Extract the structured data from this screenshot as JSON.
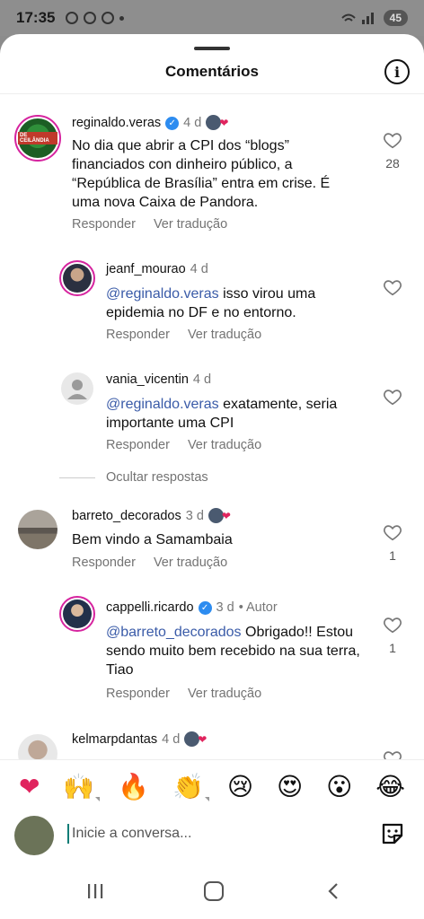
{
  "status_bar": {
    "time": "17:35",
    "battery": "45"
  },
  "header": {
    "title": "Comentários"
  },
  "comments": [
    {
      "username": "reginaldo.veras",
      "time": "4 d",
      "text": "No dia que abrir a CPI dos “blogs” financiados con dinheiro público, a “República de Brasília” entra em crise. É uma nova Caixa de Pandora.",
      "reply_label": "Responder",
      "translate_label": "Ver tradução",
      "like_count": "28",
      "avatar_text": "DE CEILÂNDIA"
    },
    {
      "username": "jeanf_mourao",
      "time": "4 d",
      "mention": "@reginaldo.veras",
      "text": " isso virou uma epidemia no DF e no entorno.",
      "reply_label": "Responder",
      "translate_label": "Ver tradução"
    },
    {
      "username": "vania_vicentin",
      "time": "4 d",
      "mention": "@reginaldo.veras",
      "text": " exatamente, seria importante uma CPI",
      "reply_label": "Responder",
      "translate_label": "Ver tradução"
    },
    {
      "username": "barreto_decorados",
      "time": "3 d",
      "text": "Bem vindo a Samambaia",
      "reply_label": "Responder",
      "translate_label": "Ver tradução",
      "like_count": "1"
    },
    {
      "username": "cappelli.ricardo",
      "time": "3 d",
      "author_label": "• Autor",
      "mention": "@barreto_decorados",
      "text": " Obrigado!! Estou sendo muito bem recebido na sua terra, Tiao",
      "reply_label": "Responder",
      "translate_label": "Ver tradução",
      "like_count": "1"
    },
    {
      "username": "kelmarpdantas",
      "time": "4 d"
    }
  ],
  "hide_replies": "Ocultar respostas",
  "emoji_bar": [
    "❤",
    "🙌",
    "🔥",
    "👏",
    "😢",
    "😍",
    "😮",
    "😂"
  ],
  "input": {
    "placeholder": "Inicie a conversa..."
  },
  "colors": {
    "accent": "#3a5ba8",
    "verified": "#2d8cf0",
    "heart_red": "#e0245e"
  }
}
